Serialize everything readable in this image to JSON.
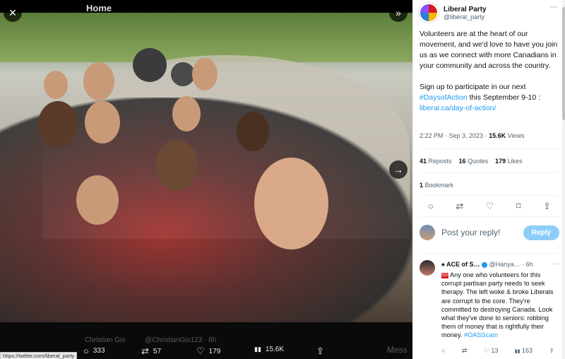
{
  "media": {
    "close_icon": "close-icon",
    "expand_icon": "double-chevron-right-icon",
    "next_icon": "arrow-right-icon",
    "home_label": "Home",
    "ghost_reply_name": "Christian Gix",
    "ghost_reply_handle": "@ChristianGix123 · 6h",
    "ghost_right": "Mess",
    "actions": [
      {
        "icon": "reply-icon",
        "glyph": "○",
        "count": "333"
      },
      {
        "icon": "repost-icon",
        "glyph": "⇄",
        "count": "57"
      },
      {
        "icon": "like-icon",
        "glyph": "♡",
        "count": "179"
      },
      {
        "icon": "views-icon",
        "glyph": "▮▮",
        "count": "15.6K"
      },
      {
        "icon": "share-icon",
        "glyph": "⇪",
        "count": ""
      }
    ],
    "status_url": "https://twitter.com/liberal_party"
  },
  "tweet": {
    "author_name": "Liberal Party",
    "author_handle": "@liberal_party",
    "more_glyph": "···",
    "text_p1": "Volunteers are at the heart of our movement, and we'd love to have you join us as we connect with more Canadians in your community and across the country.",
    "text_p2_before": "Sign up to participate in our next ",
    "hashtag": "#DaysofAction",
    "text_p2_after": " this September 9-10 : ",
    "link": "liberal.ca/day-of-action/",
    "time": "2:22 PM · Sep 3, 2023 · ",
    "views_count": "15.6K",
    "views_label": " Views",
    "reposts_count": "41",
    "reposts_label": " Reposts",
    "quotes_count": "16",
    "quotes_label": " Quotes",
    "likes_count": "179",
    "likes_label": " Likes",
    "bookmarks_count": "1",
    "bookmarks_label": " Bookmark",
    "action_icons": [
      "○",
      "⇄",
      "♡",
      "⌑",
      "⇪"
    ]
  },
  "reply_box": {
    "placeholder": "Post your reply!",
    "button": "Reply"
  },
  "comment": {
    "name": "♠ ACE of S…",
    "handle": "@Hanya… · 6h",
    "more_glyph": "···",
    "flag": "SOS",
    "text": "Any one who volunteers for this corrupt partisan party needs to seek therapy. The left woke & broke Liberals are corrupt to the core. They're committed to destroying Canada. Look what they've done to seniors: robbing them of money that is rightfully their money. ",
    "tag": "#OASScam",
    "actions": [
      {
        "glyph": "○",
        "count": ""
      },
      {
        "glyph": "⇄",
        "count": ""
      },
      {
        "glyph": "♡",
        "count": "13"
      },
      {
        "glyph": "▮▮",
        "count": "163"
      },
      {
        "glyph": "⇪",
        "count": ""
      }
    ]
  },
  "colors": {
    "accent": "#1d9bf0",
    "reply_button": "#8ecdf8",
    "text_primary": "#0f1419",
    "text_secondary": "#536471"
  }
}
